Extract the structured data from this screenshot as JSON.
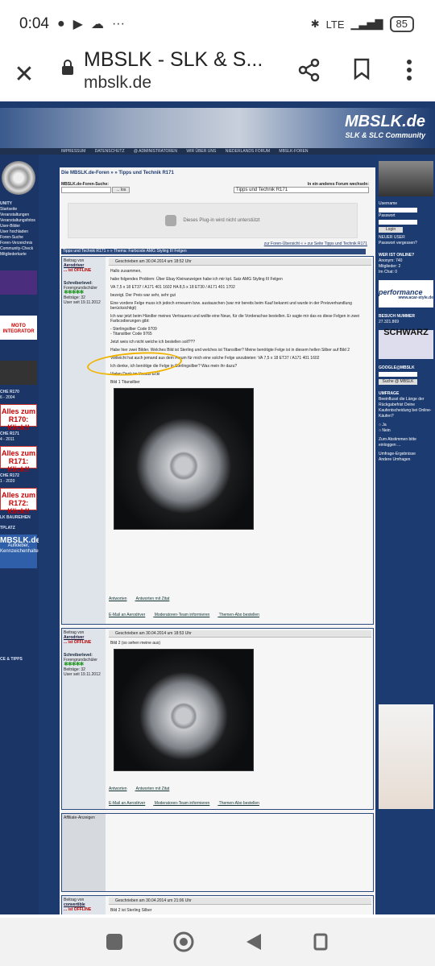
{
  "status": {
    "time": "0:04",
    "network": "LTE",
    "battery": "85"
  },
  "browser": {
    "title": "MBSLK - SLK & S...",
    "url": "mbslk.de"
  },
  "site": {
    "logo": "MBSLK.de",
    "logo_sub": "SLK & SLC Community",
    "nav": [
      "IMPRESSUM",
      "DATENSCHUTZ",
      "@ ADMINISTRATOREN",
      "WIR ÜBER UNS",
      "NIEDERLANDS FORUM",
      "MBSLK-FOREN"
    ]
  },
  "main": {
    "breadcrumb": "Die MBSLK.de-Foren » » Tipps und Technik R171",
    "search_label": "MBSLK.de-Foren-Suche:",
    "search_button": "... los",
    "switch_label": "In ein anderes Forum wechseln:",
    "switch_value": "Tipps und Technik R171",
    "plugin": "Dieses Plug-in wird nicht unterstützt",
    "forum_links": "zur Foren-Übersicht « » zur Seite Tipps und Technik R171",
    "thread_bar": "Tipps und Technik R171 » » Thema: Farbcode AMG Styling III Felgen"
  },
  "posts": [
    {
      "author_label": "Beitrag von",
      "author": "Aerodriver",
      "status": "... ist OFFLINE",
      "rank": "Schreiberlevel:",
      "rank_name": "Foren­grundschüler",
      "dots": "✱✱✱✱✱",
      "beitraege": "Beiträge: 32",
      "user_seit": "User seit 19.11.2012",
      "date": "Geschrieben am 30.04.2014 um 18:52 Uhr",
      "text": [
        "Hallo zusammen,",
        "habe folgendes Problem: Über Ebay Kleinanzeigen habe ich mir kpl. Satz AMG Styling III Felgen",
        "VA 7,5 x 18 ET37 / A171 401 1602 HA 8,5 x 18 ET30 / A171 401 1702",
        "bezeigt. Der Preis war sehr, sehr gut",
        "Eine vordere Felge muss ich jedoch erneuern bzw. austauschen (war mir bereits beim Kauf bekannt und wurde in der Preisverhandlung berücksichtigt)",
        "Ich war jetzt beim Händler meines Vertrauens und wollte eine Neue, für die Vorderachse bestellen. Er sagte mir das es diese Felgen in zwei Farbcodierungen gibt:",
        "- Sterlingsilber Code 9709",
        "- Titansilber Code 9765",
        "Jetzt weis ich nicht welche ich bestellen soll???",
        "Habe hier zwei Bilder. Welches Bild ist Sterling und welches ist Titansilber? Meine benötigte Felge ist in diesem hellen Silber auf Bild 2",
        "Vielleicht hat auch jemand aus dem Forum für mich eine solche Felge anzubieten: VA 7,5 x 18 ET37 / A171 401 1602",
        "Ich denke, ich benötige die Felge in Sterlingsilber? Was mein ihr dazu?",
        "Vielen Dank im Voraus Ecki",
        "Bild 1 Titansilber"
      ],
      "actions": [
        "Antworten",
        "Antworten mit Zitat",
        "E-Mail an Aerodriver",
        "Moderatoren-Team informieren",
        "Themen-Abo bestellen"
      ]
    },
    {
      "author_label": "Beitrag von",
      "author": "Aerodriver",
      "status": "... ist OFFLINE",
      "rank": "Schreiberlevel:",
      "rank_name": "Forengrundschüler",
      "dots": "✱✱✱✱✱",
      "beitraege": "Beiträge: 32",
      "user_seit": "User seit 19.11.2012",
      "date": "Geschrieben am 30.04.2014 um 18:53 Uhr",
      "text": [
        "Bild 2 (so sehen meine aus)"
      ],
      "actions": [
        "Antworten",
        "Antworten mit Zitat",
        "E-Mail an Aerodriver",
        "Moderatoren-Team informieren",
        "Themen-Abo bestellen"
      ]
    },
    {
      "author_label": "Beitrag von",
      "author": "convertible",
      "status": "... ist OFFLINE",
      "date": "Geschrieben am 30.04.2014 um 21:06 Uhr",
      "text": [
        "Bild 2 ist Sterling Silber"
      ]
    }
  ],
  "affiliate": "Affiliate-Anzeigen",
  "left": {
    "sections": [
      "UNITY",
      "CHE R170",
      "CHE R171",
      "CHE R172",
      "LK BAUREIHEN",
      "TPLATZ",
      "CE & TIPPS"
    ],
    "links1": [
      "Startseite",
      "Veranstaltungen",
      "Veranstaltungsfotos",
      "User-Bilder",
      "User hochladen",
      "Foren-Suche",
      "Foren-Verzeichnis",
      "Community-Check",
      "Mitgliederkarte"
    ],
    "ad_text1": "Alles zum R170: Klick!!",
    "ad_text2": "Alles zum R171: Klick!!",
    "ad_text3": "Alles zum R172: Klick!!",
    "range1": "6 - 2004",
    "range2": "4 - 2011",
    "range3": "1 - 2020",
    "slk_box": "MBSLK.de",
    "slk_sub": "Aufkleber, Kennzeichenhalter",
    "moto": "MOTO INTEGRATOR"
  },
  "right": {
    "username_label": "Username",
    "password_label": "Passwort",
    "login": "Login",
    "new_user": "NEUER USER",
    "forgot": "Passwort vergessen?",
    "online_h": "WER IST ONLINE?",
    "online": [
      "Anonym: 740",
      "Mitglieder: 2",
      "Im Chat: 0"
    ],
    "perf": "performance",
    "perf_url": "www.acar-style.de",
    "visitors_h": "BESUCH NUMMER",
    "visitors": "27.321.869",
    "schwarz": "SCHWARZ",
    "google_h": "GOOGLE@MBSLK",
    "google_btn": "Suche @ MBSLK",
    "poll_h": "UMFRAGE",
    "poll_q": "Beeinflusst die Länge der Rückgabefrist Deine Kaufentscheidung bei Online-Käufen?",
    "poll_yes": "Ja",
    "poll_no": "Nein",
    "poll_note": "Zum Abstimmen bitte einloggen ...",
    "poll_results": "Umfrage-Ergebnisse",
    "poll_other": "Andere Umfragen"
  }
}
